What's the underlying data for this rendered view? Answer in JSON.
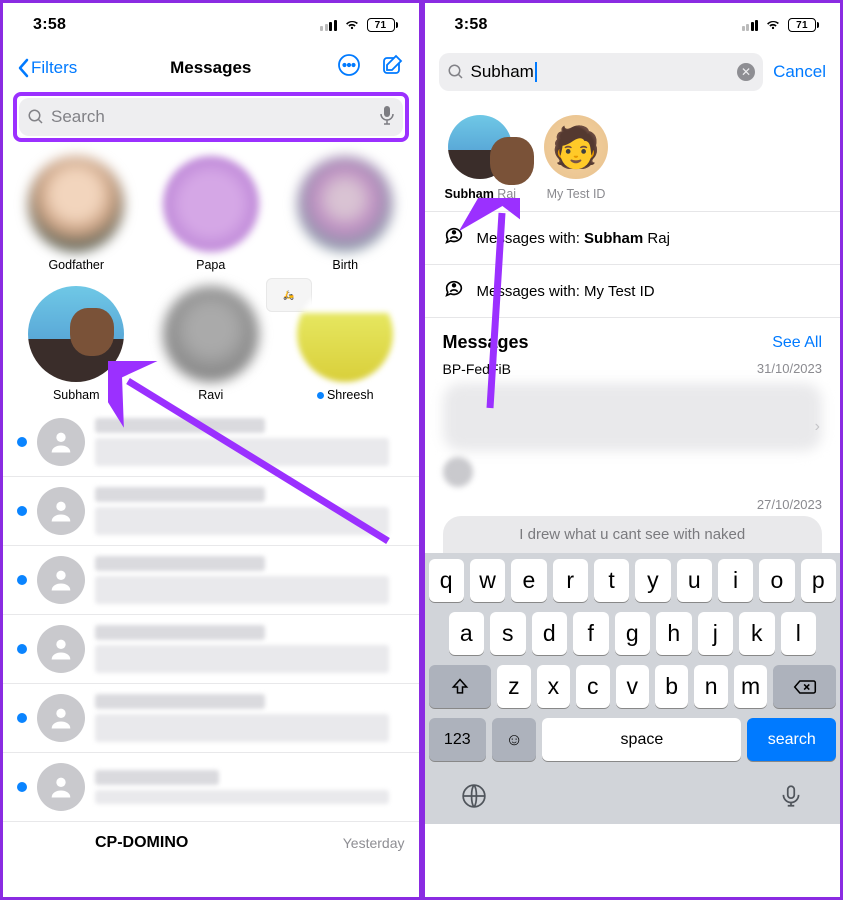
{
  "statusbar": {
    "time": "3:58",
    "battery": "71"
  },
  "left": {
    "backLabel": "Filters",
    "title": "Messages",
    "searchPlaceholder": "Search",
    "contacts": [
      {
        "name": "Godfather"
      },
      {
        "name": "Papa"
      },
      {
        "name": "Birth"
      },
      {
        "name": "Subham"
      },
      {
        "name": "Ravi"
      },
      {
        "name": "Shreesh"
      }
    ],
    "lastConvName": "CP-DOMINO",
    "lastConvTime": "Yesterday"
  },
  "right": {
    "searchQuery": "Subham",
    "cancel": "Cancel",
    "contactResults": [
      {
        "bold": "Subham",
        "light": " Raj"
      },
      {
        "bold": "",
        "light": "My Test ID"
      }
    ],
    "msgWith": [
      {
        "prefix": "Messages with: ",
        "bold": "Subham",
        "rest": " Raj"
      },
      {
        "prefix": "Messages with: ",
        "bold": "",
        "rest": "My Test ID"
      }
    ],
    "sectionHeader": "Messages",
    "seeAll": "See All",
    "sender1": "BP-FedFiB",
    "date1": "31/10/2023",
    "date2": "27/10/2023",
    "partialMsg": "I drew what u cant see with naked"
  },
  "keyboard": {
    "row1": [
      "q",
      "w",
      "e",
      "r",
      "t",
      "y",
      "u",
      "i",
      "o",
      "p"
    ],
    "row2": [
      "a",
      "s",
      "d",
      "f",
      "g",
      "h",
      "j",
      "k",
      "l"
    ],
    "row3": [
      "z",
      "x",
      "c",
      "v",
      "b",
      "n",
      "m"
    ],
    "numKey": "123",
    "space": "space",
    "search": "search"
  }
}
